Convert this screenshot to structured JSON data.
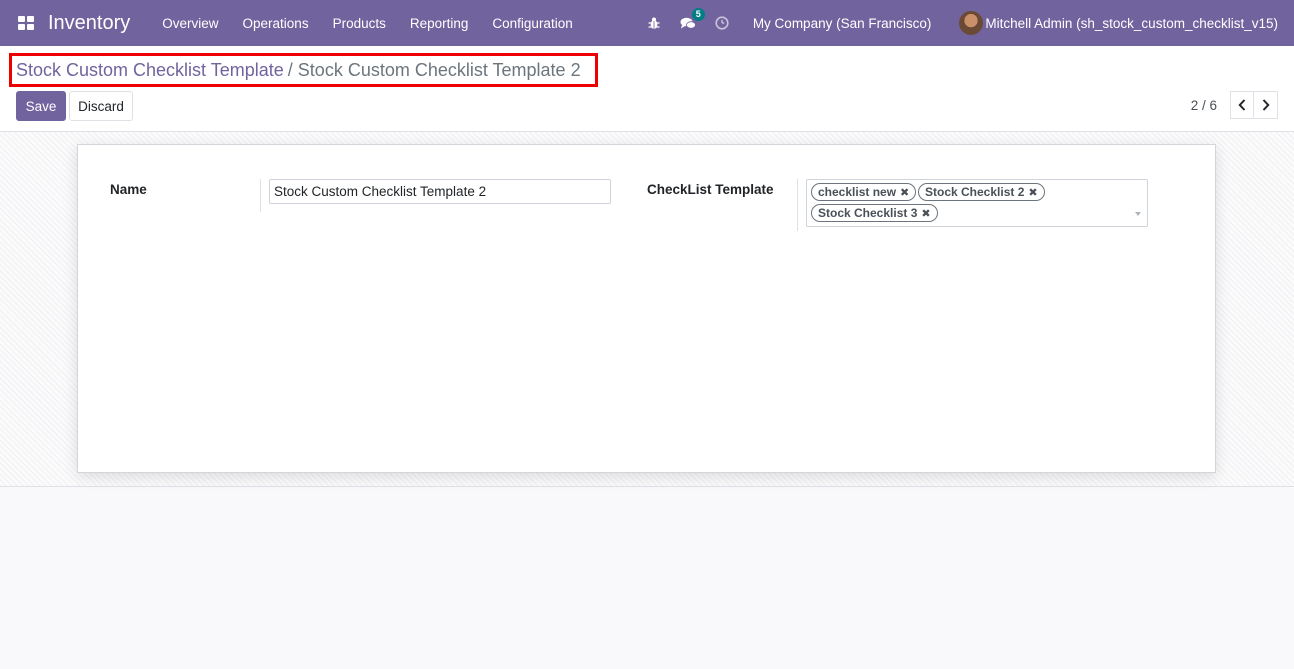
{
  "navbar": {
    "app_name": "Inventory",
    "menu": [
      "Overview",
      "Operations",
      "Products",
      "Reporting",
      "Configuration"
    ],
    "icons": [
      "apps-grid-icon",
      "bug-icon",
      "chat-icon",
      "clock-icon"
    ],
    "messages_badge": "5",
    "company": "My Company (San Francisco)",
    "user": "Mitchell Admin (sh_stock_custom_checklist_v15)"
  },
  "breadcrumb": {
    "parent": "Stock Custom Checklist Template",
    "separator": "/",
    "current": "Stock Custom Checklist Template 2"
  },
  "actions": {
    "save_label": "Save",
    "discard_label": "Discard"
  },
  "pager": {
    "text": "2 / 6"
  },
  "form": {
    "name_label": "Name",
    "name_value": "Stock Custom Checklist Template 2",
    "checklist_label": "CheckList Template",
    "tags": [
      "checklist new",
      "Stock Checklist 2",
      "Stock Checklist 3"
    ],
    "tag_remove_glyph": "✖"
  },
  "colors": {
    "brand": "#71639e",
    "highlight_border": "#ee0000",
    "badge": "#017e84"
  }
}
